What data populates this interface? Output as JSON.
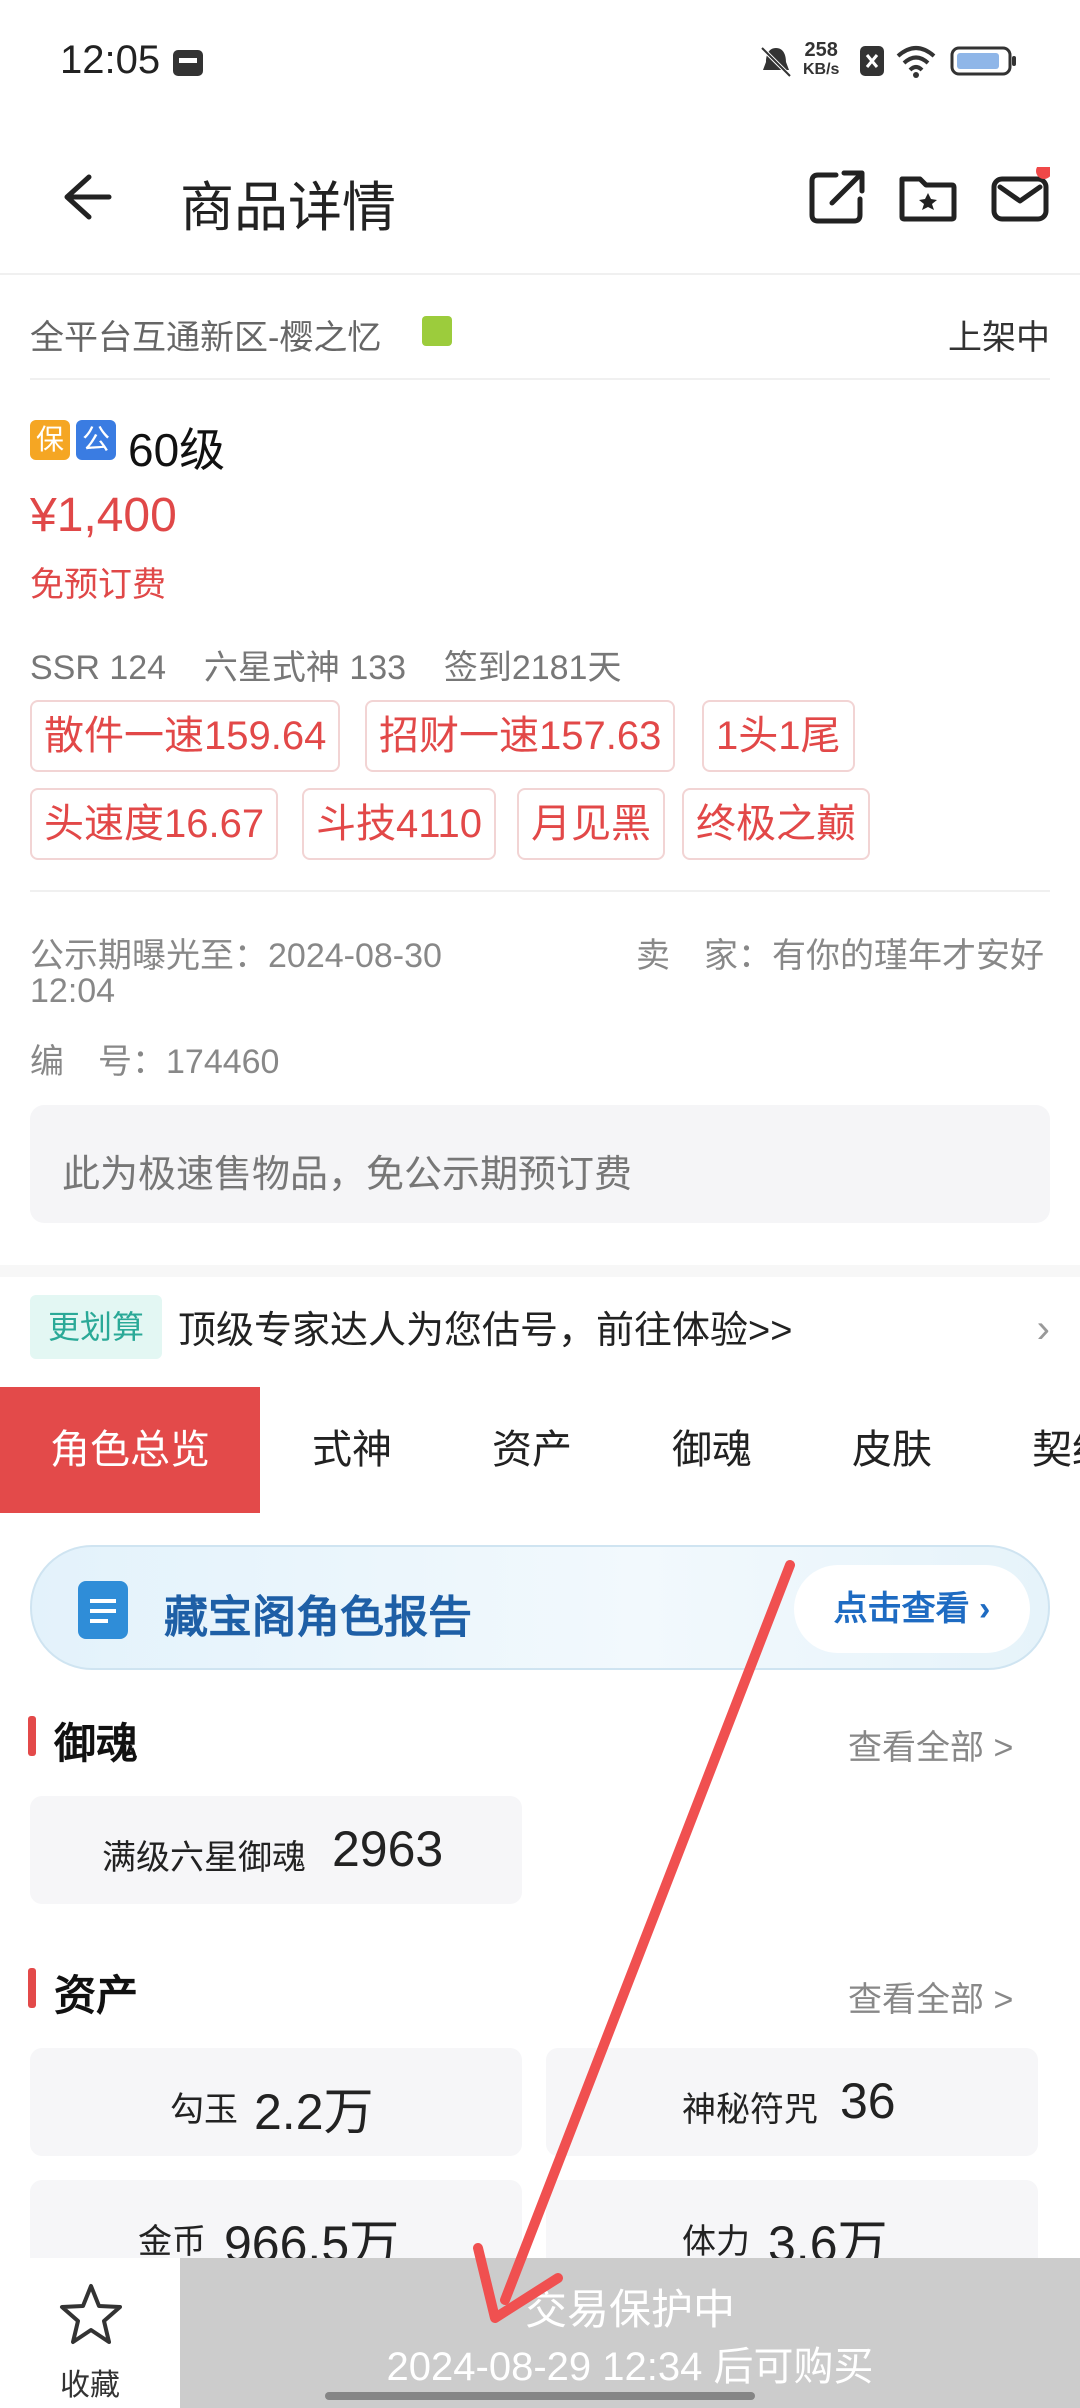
{
  "status_bar": {
    "time": "12:05",
    "net_speed": "258",
    "net_unit": "KB/s"
  },
  "header": {
    "title": "商品详情"
  },
  "listing": {
    "server": "全平台互通新区-樱之忆",
    "status": "上架中",
    "badges": [
      "保",
      "公"
    ],
    "level": "60级",
    "price": "¥1,400",
    "fee": "免预订费",
    "stats": "SSR 124    六星式神 133    签到2181天",
    "tags": [
      "散件一速159.64",
      "招财一速157.63",
      "1头1尾",
      "头速度16.67",
      "斗技4110",
      "月见黑",
      "终极之巅"
    ],
    "expose_label": "公示期曝光至：",
    "expose_date": "2024-08-30",
    "expose_time": "12:04",
    "seller_label": "卖　家：",
    "seller_name": "有你的瑾年才安好",
    "id_label": "编　号：",
    "id_value": "174460",
    "notice": "此为极速售物品，免公示期预订费"
  },
  "promo": {
    "badge": "更划算",
    "text": "顶级专家达人为您估号，前往体验>>",
    "arrow": "›"
  },
  "tabs": [
    "角色总览",
    "式神",
    "资产",
    "御魂",
    "皮肤",
    "契约"
  ],
  "banner": {
    "title": "藏宝阁角色报告",
    "button": "点击查看 ›"
  },
  "yuhun": {
    "title": "御魂",
    "more": "查看全部 >",
    "card": {
      "label": "满级六星御魂",
      "value": "2963"
    }
  },
  "assets": {
    "title": "资产",
    "more": "查看全部 >",
    "cards": [
      {
        "label": "勾玉",
        "value": "2.2万"
      },
      {
        "label": "神秘符咒",
        "value": "36"
      },
      {
        "label": "金币",
        "value": "966.5万"
      },
      {
        "label": "体力",
        "value": "3.6万"
      }
    ]
  },
  "bottom": {
    "fav_label": "收藏",
    "buy_line1": "交易保护中",
    "buy_line2": "2024-08-29 12:34 后可购买"
  },
  "colors": {
    "accent_red": "#e34a4a",
    "price_red": "#e04848",
    "annotation_arrow": "#f05050",
    "disabled_gray": "#cccccc"
  },
  "icons": [
    "back-arrow-icon",
    "share-icon",
    "folder-star-icon",
    "mail-icon",
    "android-icon",
    "star-icon",
    "clipboard-icon"
  ]
}
